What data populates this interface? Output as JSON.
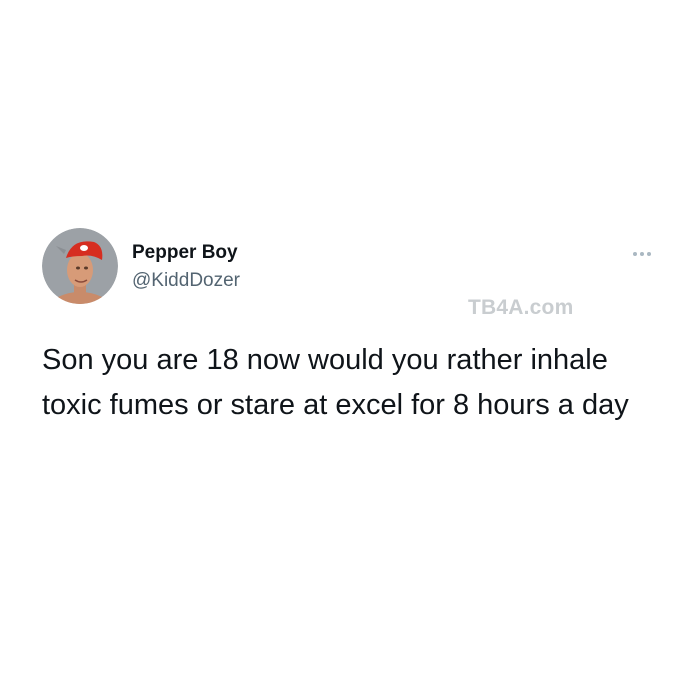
{
  "tweet": {
    "display_name": "Pepper Boy",
    "handle": "@KiddDozer",
    "text": "Son you are 18 now would you rather inhale toxic fumes or stare at excel for 8 hours a day",
    "avatar_icon": "profile-photo-avatar",
    "more_icon": "more-options-icon"
  },
  "watermark": {
    "text": "TB4A.com"
  },
  "colors": {
    "background": "#ffffff",
    "text_primary": "#0f1419",
    "text_secondary": "#536471",
    "more_dots": "#aab8c2",
    "watermark": "#c9cdd0",
    "avatar_hat": "#d62d20"
  }
}
